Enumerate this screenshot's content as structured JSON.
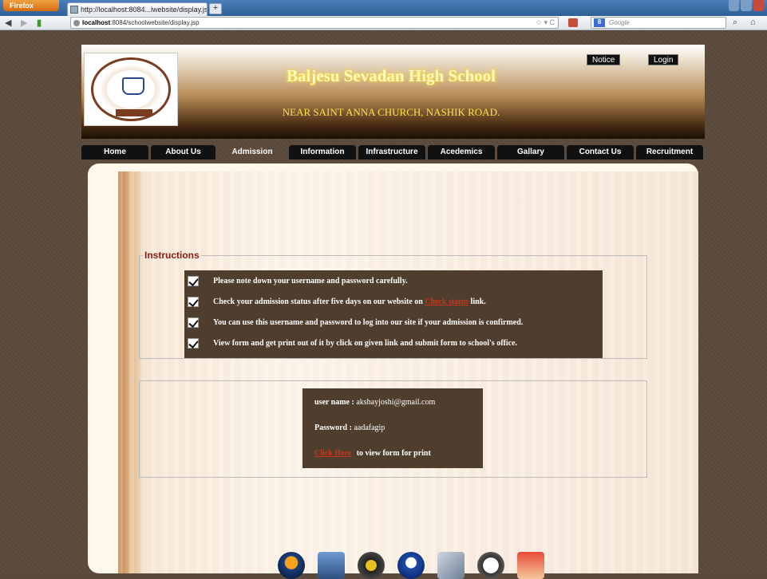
{
  "browser": {
    "app_button": "Firefox",
    "tab_title": "http://localhost:8084...lwebsite/display.jsp",
    "new_tab": "+",
    "url_host": "localhost",
    "url_rest": ":8084/schoolwebsite/display.jsp",
    "search_placeholder": "Google"
  },
  "header": {
    "school_name": "Baljesu Sevadan High School",
    "address": "NEAR SAINT ANNA CHURCH, NASHIK ROAD.",
    "notice_label": "Notice",
    "login_label": "Login"
  },
  "menu": {
    "items": [
      {
        "label": "Home"
      },
      {
        "label": "About Us"
      },
      {
        "label": "Admission"
      },
      {
        "label": "Information"
      },
      {
        "label": "Infrastructure"
      },
      {
        "label": "Acedemics"
      },
      {
        "label": "Gallary"
      },
      {
        "label": "Contact Us"
      },
      {
        "label": "Recruitment"
      }
    ],
    "active": "Admission"
  },
  "instructions": {
    "legend": "Instructions",
    "items": [
      {
        "text": "Please note down your username and password carefully."
      },
      {
        "before": "Check your admission status after five days on our website on",
        "link": "Check status",
        "after": "link."
      },
      {
        "text": "You can use this username and password to log into our site if your admission is confirmed."
      },
      {
        "text": "View form and get print out of it by click on given link and submit form to school's office."
      }
    ]
  },
  "credentials": {
    "username_label": "user name : ",
    "username": "akshayjoshi@gmail.com",
    "password_label": "Password : ",
    "password": "aadafagip",
    "link": "Click Here",
    "link_after": "to view form for print"
  },
  "colors": {
    "accent_red": "#c8371d",
    "box_brown": "#4f3e2e",
    "legend_red": "#8a1d14",
    "title_glow": "#ffe14d"
  },
  "bottom_icons": [
    "home-icon",
    "camera-icon",
    "disc-icon",
    "tools-icon",
    "key-icon",
    "people-icon"
  ]
}
